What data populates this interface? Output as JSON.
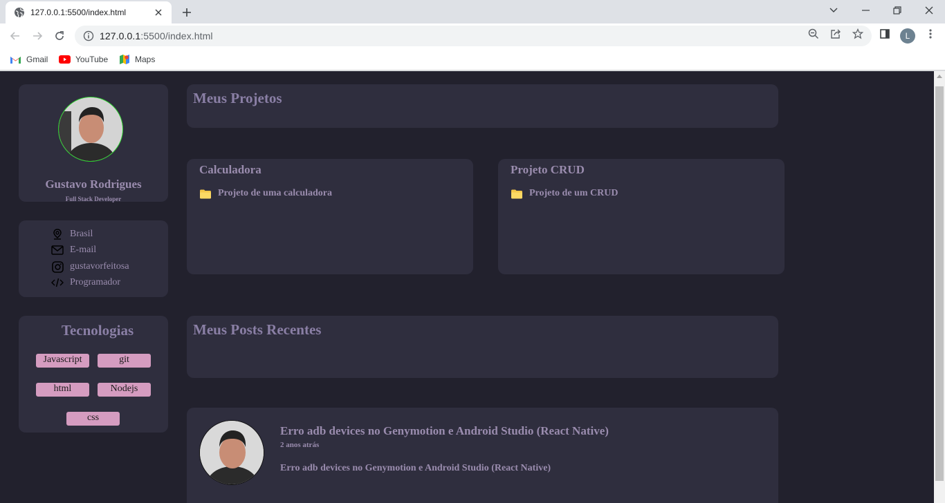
{
  "browser": {
    "tab_title": "127.0.0.1:5500/index.html",
    "url_host": "127.0.0.1",
    "url_rest": ":5500/index.html",
    "profile_initial": "L",
    "bookmarks": [
      {
        "label": "Gmail",
        "icon": "gmail-icon"
      },
      {
        "label": "YouTube",
        "icon": "youtube-icon"
      },
      {
        "label": "Maps",
        "icon": "maps-icon"
      }
    ]
  },
  "profile": {
    "name": "Gustavo Rodrigues",
    "role": "Full Stack Developer"
  },
  "info": {
    "items": [
      {
        "icon": "location-pin-icon",
        "label": "Brasil"
      },
      {
        "icon": "envelope-icon",
        "label": "E-mail"
      },
      {
        "icon": "instagram-icon",
        "label": "gustavorfeitosa"
      },
      {
        "icon": "code-icon",
        "label": "Programador"
      }
    ]
  },
  "tech": {
    "title": "Tecnologias",
    "tags": [
      "Javascript",
      "git",
      "html",
      "Nodejs",
      "css"
    ]
  },
  "projects": {
    "title": "Meus Projetos",
    "items": [
      {
        "title": "Calculadora",
        "description": "Projeto de uma calculadora"
      },
      {
        "title": "Projeto CRUD",
        "description": "Projeto de um CRUD"
      }
    ]
  },
  "posts": {
    "title": "Meus Posts Recentes",
    "items": [
      {
        "title": "Erro adb devices no Genymotion e Android Studio (React Native)",
        "time": "2 anos atrás",
        "body": "Erro adb devices no Genymotion e Android Studio (React Native)"
      }
    ]
  },
  "colors": {
    "page_bg": "#22212d",
    "card_bg": "#2f2e3e",
    "text_purple": "#9a8cae",
    "tag_pink": "#d59cc0",
    "avatar_ring": "#2ad62a"
  }
}
